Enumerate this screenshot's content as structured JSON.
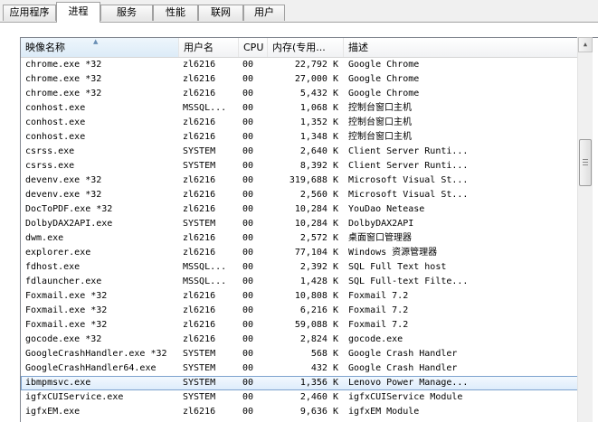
{
  "tabs": [
    {
      "label": "应用程序"
    },
    {
      "label": "进程"
    },
    {
      "label": "服务"
    },
    {
      "label": "性能"
    },
    {
      "label": "联网"
    },
    {
      "label": "用户"
    }
  ],
  "active_tab": 1,
  "columns": {
    "name": "映像名称",
    "user": "用户名",
    "cpu": "CPU",
    "mem": "内存(专用...",
    "desc": "描述"
  },
  "rows": [
    {
      "name": "chrome.exe *32",
      "user": "zl6216",
      "cpu": "00",
      "mem": "22,792 K",
      "desc": "Google Chrome"
    },
    {
      "name": "chrome.exe *32",
      "user": "zl6216",
      "cpu": "00",
      "mem": "27,000 K",
      "desc": "Google Chrome"
    },
    {
      "name": "chrome.exe *32",
      "user": "zl6216",
      "cpu": "00",
      "mem": "5,432 K",
      "desc": "Google Chrome"
    },
    {
      "name": "conhost.exe",
      "user": "MSSQL...",
      "cpu": "00",
      "mem": "1,068 K",
      "desc": "控制台窗口主机"
    },
    {
      "name": "conhost.exe",
      "user": "zl6216",
      "cpu": "00",
      "mem": "1,352 K",
      "desc": "控制台窗口主机"
    },
    {
      "name": "conhost.exe",
      "user": "zl6216",
      "cpu": "00",
      "mem": "1,348 K",
      "desc": "控制台窗口主机"
    },
    {
      "name": "csrss.exe",
      "user": "SYSTEM",
      "cpu": "00",
      "mem": "2,640 K",
      "desc": "Client Server Runti..."
    },
    {
      "name": "csrss.exe",
      "user": "SYSTEM",
      "cpu": "00",
      "mem": "8,392 K",
      "desc": "Client Server Runti..."
    },
    {
      "name": "devenv.exe *32",
      "user": "zl6216",
      "cpu": "00",
      "mem": "319,688 K",
      "desc": "Microsoft Visual St..."
    },
    {
      "name": "devenv.exe *32",
      "user": "zl6216",
      "cpu": "00",
      "mem": "2,560 K",
      "desc": "Microsoft Visual St..."
    },
    {
      "name": "DocToPDF.exe *32",
      "user": "zl6216",
      "cpu": "00",
      "mem": "10,284 K",
      "desc": "YouDao Netease"
    },
    {
      "name": "DolbyDAX2API.exe",
      "user": "SYSTEM",
      "cpu": "00",
      "mem": "10,284 K",
      "desc": "DolbyDAX2API"
    },
    {
      "name": "dwm.exe",
      "user": "zl6216",
      "cpu": "00",
      "mem": "2,572 K",
      "desc": "桌面窗口管理器"
    },
    {
      "name": "explorer.exe",
      "user": "zl6216",
      "cpu": "00",
      "mem": "77,104 K",
      "desc": "Windows 资源管理器"
    },
    {
      "name": "fdhost.exe",
      "user": "MSSQL...",
      "cpu": "00",
      "mem": "2,392 K",
      "desc": "SQL Full Text host"
    },
    {
      "name": "fdlauncher.exe",
      "user": "MSSQL...",
      "cpu": "00",
      "mem": "1,428 K",
      "desc": "SQL Full-text Filte..."
    },
    {
      "name": "Foxmail.exe *32",
      "user": "zl6216",
      "cpu": "00",
      "mem": "10,808 K",
      "desc": "Foxmail 7.2"
    },
    {
      "name": "Foxmail.exe *32",
      "user": "zl6216",
      "cpu": "00",
      "mem": "6,216 K",
      "desc": "Foxmail 7.2"
    },
    {
      "name": "Foxmail.exe *32",
      "user": "zl6216",
      "cpu": "00",
      "mem": "59,088 K",
      "desc": "Foxmail 7.2"
    },
    {
      "name": "gocode.exe *32",
      "user": "zl6216",
      "cpu": "00",
      "mem": "2,824 K",
      "desc": "gocode.exe"
    },
    {
      "name": "GoogleCrashHandler.exe *32",
      "user": "SYSTEM",
      "cpu": "00",
      "mem": "568 K",
      "desc": "Google Crash Handler"
    },
    {
      "name": "GoogleCrashHandler64.exe",
      "user": "SYSTEM",
      "cpu": "00",
      "mem": "432 K",
      "desc": "Google Crash Handler"
    },
    {
      "name": "ibmpmsvc.exe",
      "user": "SYSTEM",
      "cpu": "00",
      "mem": "1,356 K",
      "desc": "Lenovo Power Manage..."
    },
    {
      "name": "igfxCUIService.exe",
      "user": "SYSTEM",
      "cpu": "00",
      "mem": "2,460 K",
      "desc": "igfxCUIService Module"
    },
    {
      "name": "igfxEM.exe",
      "user": "zl6216",
      "cpu": "00",
      "mem": "9,636 K",
      "desc": "igfxEM Module"
    }
  ],
  "selected_row": 22,
  "scrollbar": {
    "up_icon": "▲"
  }
}
